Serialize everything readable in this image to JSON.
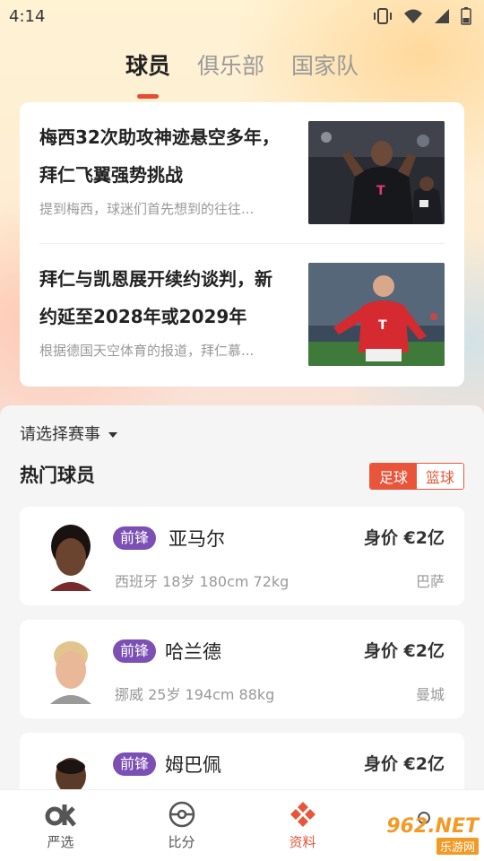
{
  "status_bar": {
    "time": "4:14"
  },
  "top_tabs": [
    {
      "label": "球员",
      "active": true
    },
    {
      "label": "俱乐部",
      "active": false
    },
    {
      "label": "国家队",
      "active": false
    }
  ],
  "news": [
    {
      "title": "梅西32次助攻神迹悬空多年，拜仁飞翼强势挑战",
      "summary": "提到梅西，球迷们首先想到的往往..."
    },
    {
      "title": "拜仁与凯恩展开续约谈判，新约延至2028年或2029年",
      "summary": "根据德国天空体育的报道，拜仁慕..."
    }
  ],
  "filter": {
    "label": "请选择赛事"
  },
  "section": {
    "title": "热门球员"
  },
  "sport_toggle": {
    "football": "足球",
    "basketball": "篮球",
    "active": "football"
  },
  "players": [
    {
      "position": "前锋",
      "name": "亚马尔",
      "meta": "西班牙 18岁 180cm 72kg",
      "value": "身价 €2亿",
      "club": "巴萨"
    },
    {
      "position": "前锋",
      "name": "哈兰德",
      "meta": "挪威 25岁 194cm 88kg",
      "value": "身价 €2亿",
      "club": "曼城"
    },
    {
      "position": "前锋",
      "name": "姆巴佩",
      "meta": "",
      "value": "身价 €2亿",
      "club": ""
    }
  ],
  "bottom_nav": [
    {
      "label": "严选",
      "icon": "ok-logo-icon",
      "active": false
    },
    {
      "label": "比分",
      "icon": "ball-icon",
      "active": false
    },
    {
      "label": "资料",
      "icon": "diamond-cluster-icon",
      "active": true
    },
    {
      "label": "",
      "icon": "profile-icon",
      "active": false
    }
  ],
  "watermark": {
    "top": "962.NET",
    "bottom": "乐游网"
  },
  "colors": {
    "accent": "#e8553a",
    "badge": "#7b4fb3"
  }
}
